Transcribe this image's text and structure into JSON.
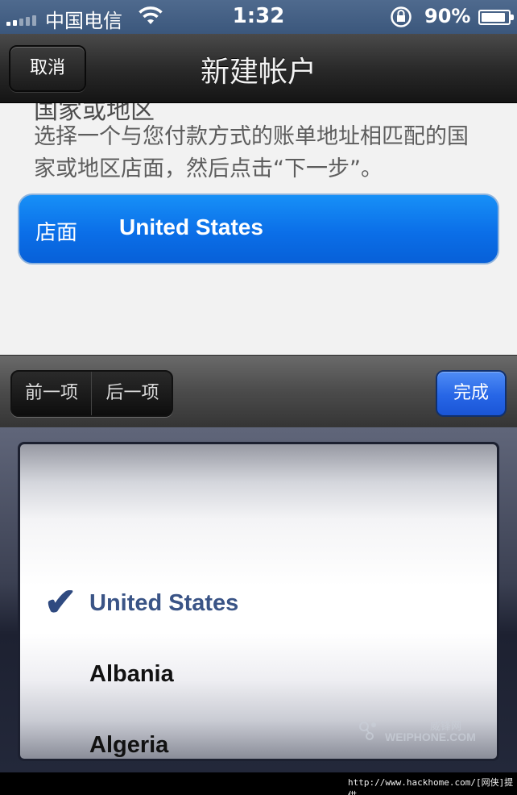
{
  "status_bar": {
    "carrier": "中国电信",
    "time": "1:32",
    "battery_percent": "90%",
    "battery_level": 0.9
  },
  "nav_bar": {
    "cancel_label": "取消",
    "title": "新建帐户"
  },
  "content": {
    "section_title": "国家或地区",
    "description": "选择一个与您付款方式的账单地址相匹配的国家或地区店面，然后点击“下一步”。",
    "store_label": "店面",
    "store_value": "United States",
    "store_color": "#0b6fe8"
  },
  "toolbar": {
    "prev_label": "前一项",
    "next_label": "后一项",
    "done_label": "完成"
  },
  "picker": {
    "items": [
      {
        "label": "United States",
        "selected": true
      },
      {
        "label": "Albania",
        "selected": false
      },
      {
        "label": "Algeria",
        "selected": false
      }
    ],
    "check_icon": "checkmark-icon"
  },
  "watermark": {
    "cn": "威锋网",
    "en": "WEIPHONE.COM"
  },
  "footer": {
    "url": "http://www.hackhome.com/[网侠]提供"
  }
}
